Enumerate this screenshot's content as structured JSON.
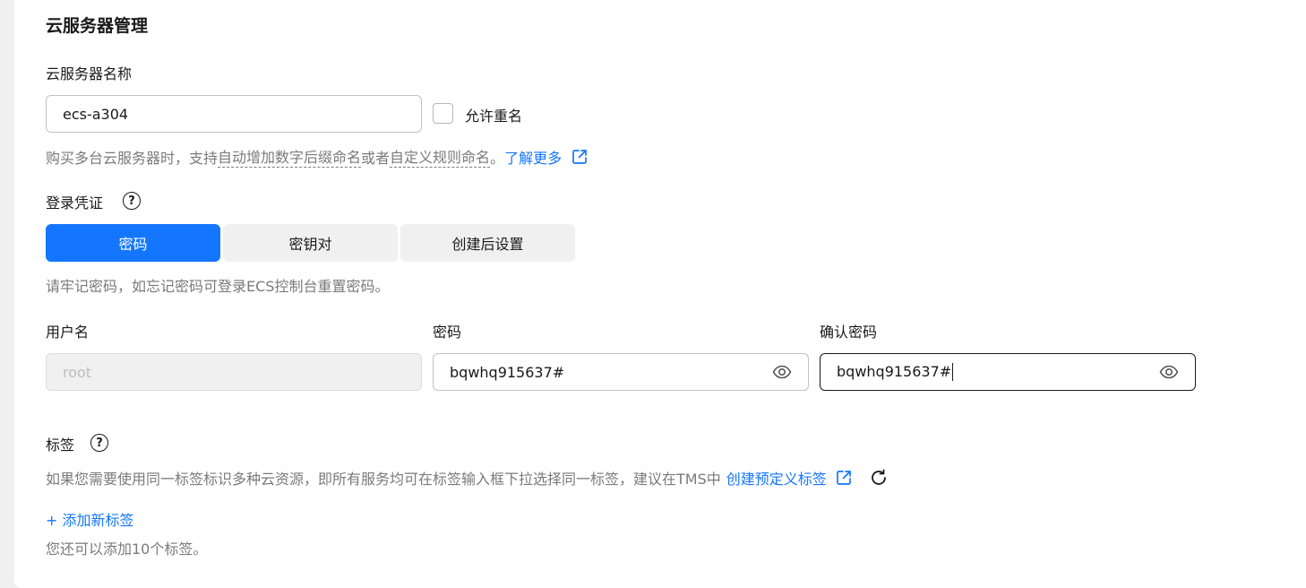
{
  "section": {
    "title": "云服务器管理"
  },
  "name_field": {
    "label": "云服务器名称",
    "value": "ecs-a304",
    "allow_duplicate_label": "允许重名",
    "allow_duplicate_checked": false,
    "hint_prefix": "购买多台云服务器时，支持",
    "hint_term1": "自动增加数字后缀命名",
    "hint_mid": "或者",
    "hint_term2": "自定义规则命名",
    "hint_suffix": "。",
    "learn_more": "了解更多"
  },
  "credentials": {
    "label": "登录凭证",
    "options": [
      "密码",
      "密钥对",
      "创建后设置"
    ],
    "selected": "密码",
    "hint": "请牢记密码，如忘记密码可登录ECS控制台重置密码。",
    "username_label": "用户名",
    "username_value": "root",
    "password_label": "密码",
    "password_value": "bqwhq915637#",
    "confirm_label": "确认密码",
    "confirm_value": "bqwhq915637#"
  },
  "tags": {
    "label": "标签",
    "hint": "如果您需要使用同一标签标识多种云资源，即所有服务均可在标签输入框下拉选择同一标签，建议在TMS中",
    "create_link": "创建预定义标签",
    "add_tag": "+ 添加新标签",
    "remaining": "您还可以添加10个标签。"
  },
  "colors": {
    "primary": "#1476ff",
    "text": "#191919",
    "hint": "#7a7a7a",
    "background": "#f0f0f0"
  },
  "icons": {
    "help": "question-circle-icon",
    "external": "external-link-icon",
    "eye": "eye-icon",
    "refresh": "refresh-icon"
  }
}
